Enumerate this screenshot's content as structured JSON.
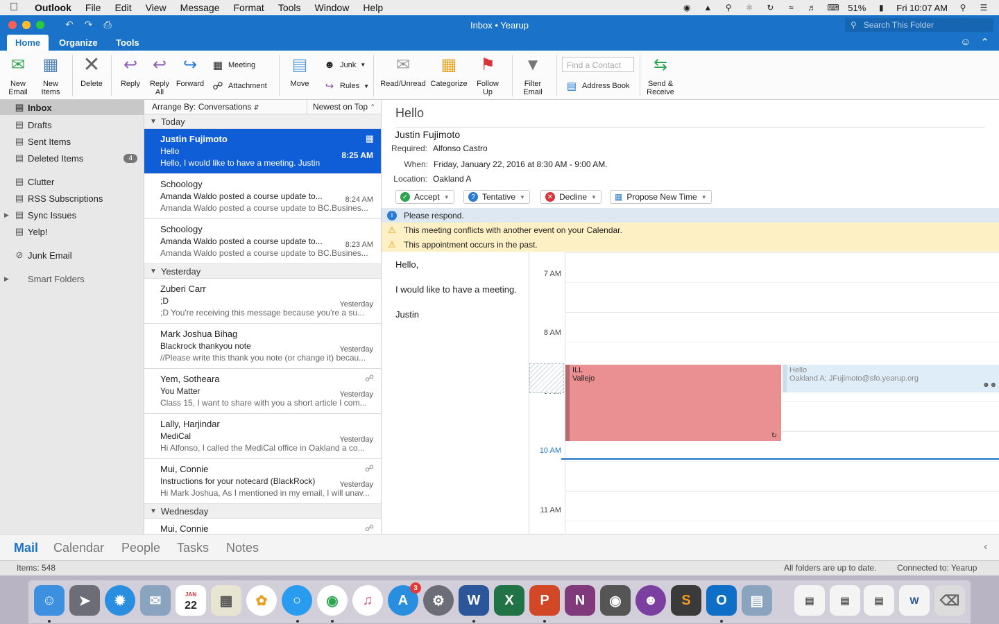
{
  "menubar": {
    "app": "Outlook",
    "items": [
      "File",
      "Edit",
      "View",
      "Message",
      "Format",
      "Tools",
      "Window",
      "Help"
    ],
    "battery": "51%",
    "clock": "Fri 10:07 AM"
  },
  "titlebar": {
    "title": "Inbox • Yearup",
    "search_placeholder": "Search This Folder"
  },
  "tabs": [
    "Home",
    "Organize",
    "Tools"
  ],
  "ribbon": {
    "new_email": "New\nEmail",
    "new_items": "New\nItems",
    "delete": "Delete",
    "reply": "Reply",
    "reply_all": "Reply\nAll",
    "forward": "Forward",
    "meeting": "Meeting",
    "attachment": "Attachment",
    "move": "Move",
    "junk": "Junk",
    "rules": "Rules",
    "read_unread": "Read/Unread",
    "categorize": "Categorize",
    "follow_up": "Follow\nUp",
    "filter_email": "Filter\nEmail",
    "find_contact_placeholder": "Find a Contact",
    "address_book": "Address Book",
    "send_receive": "Send &\nReceive"
  },
  "folders": [
    {
      "label": "Inbox",
      "icon": "inbox-icon",
      "selected": true
    },
    {
      "label": "Drafts",
      "icon": "drafts-icon"
    },
    {
      "label": "Sent Items",
      "icon": "sent-icon"
    },
    {
      "label": "Deleted Items",
      "icon": "trash-icon",
      "badge": "4"
    },
    {
      "label": "Clutter",
      "icon": "folder-icon"
    },
    {
      "label": "RSS Subscriptions",
      "icon": "folder-icon"
    },
    {
      "label": "Sync Issues",
      "icon": "folder-icon"
    },
    {
      "label": "Yelp!",
      "icon": "folder-icon"
    },
    {
      "label": "Junk Email",
      "icon": "junk-icon"
    },
    {
      "label": "Smart Folders",
      "icon": "none"
    }
  ],
  "list": {
    "arrange_by": "Arrange By: Conversations",
    "sort": "Newest on Top",
    "groups": [
      {
        "label": "Today",
        "messages": [
          {
            "from": "Justin Fujimoto",
            "subject": "Hello",
            "time": "8:25 AM",
            "preview": "Hello, I would like to have a meeting. Justin"
          },
          {
            "from": "Schoology",
            "subject": "Amanda Waldo posted a course update to...",
            "time": "8:24 AM",
            "preview": "Amanda Waldo posted a course update to BC.Busines..."
          },
          {
            "from": "Schoology",
            "subject": "Amanda Waldo posted a course update to...",
            "time": "8:23 AM",
            "preview": "Amanda Waldo posted a course update to BC.Busines..."
          }
        ]
      },
      {
        "label": "Yesterday",
        "messages": [
          {
            "from": "Zuberi Carr",
            "subject": ";D",
            "time": "Yesterday",
            "preview": ";D You're receiving this message because you're a su..."
          },
          {
            "from": "Mark Joshua Bihag",
            "subject": "Blackrock thankyou note",
            "time": "Yesterday",
            "preview": "//Please write this thank you note (or change it) becau..."
          },
          {
            "from": "Yem, Sotheara",
            "subject": "You Matter",
            "time": "Yesterday",
            "preview": "Class 15, I want to share with you a short article I com..."
          },
          {
            "from": "Lally, Harjindar",
            "subject": "MediCal",
            "time": "Yesterday",
            "preview": "Hi Alfonso, I called the MediCal office in Oakland a co..."
          },
          {
            "from": "Mui, Connie",
            "subject": "Instructions for your notecard (BlackRock)",
            "time": "Yesterday",
            "preview": "Hi Mark Joshua, As I mentioned in my email, I will unav..."
          }
        ]
      },
      {
        "label": "Wednesday",
        "messages": [
          {
            "from": "Mui, Connie",
            "subject": "",
            "time": "",
            "preview": ""
          }
        ]
      }
    ]
  },
  "reading": {
    "subject": "Hello",
    "sender": "Justin Fujimoto",
    "required_label": "Required:",
    "required": "Alfonso Castro",
    "when_label": "When:",
    "when": "Friday, January 22, 2016 at 8:30 AM - 9:00 AM.",
    "location_label": "Location:",
    "location": "Oakland A",
    "accept": "Accept",
    "tentative": "Tentative",
    "decline": "Decline",
    "propose": "Propose New Time",
    "info_respond": "Please respond.",
    "info_conflict": "This meeting conflicts with another event on your Calendar.",
    "info_past": "This appointment occurs in the past.",
    "body": [
      "Hello,",
      "I would like to have a meeting.",
      "Justin"
    ],
    "calendar": {
      "hours": [
        "7 AM",
        "8 AM",
        "9 AM",
        "10 AM",
        "11 AM"
      ],
      "event1_title": "ILL",
      "event1_location": "Vallejo",
      "event2_title": "Hello",
      "event2_details": "Oakland A; JFujimoto@sfo.yearup.org"
    }
  },
  "bottomnav": [
    "Mail",
    "Calendar",
    "People",
    "Tasks",
    "Notes"
  ],
  "status": {
    "items": "Items: 548",
    "sync": "All folders are up to date.",
    "connected": "Connected to: Yearup"
  },
  "dock": {
    "calendar_month": "JAN",
    "calendar_day": "22",
    "appstore_badge": "3"
  },
  "colors": {
    "accent": "#1a73c8",
    "selected_row": "#0f5ed7",
    "conflict_bar": "#fdf0c4",
    "info_bar": "#dde8f3",
    "event_busy": "#ea8f92"
  }
}
